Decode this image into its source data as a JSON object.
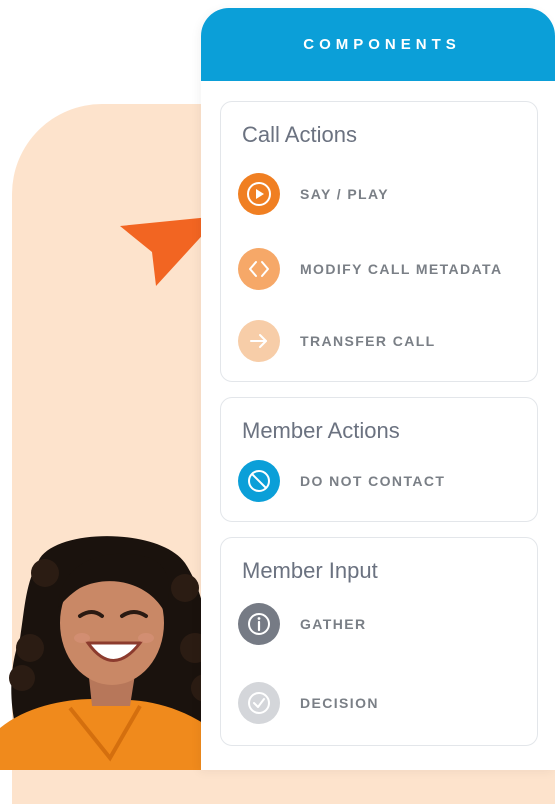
{
  "panel": {
    "title": "COMPONENTS"
  },
  "sections": [
    {
      "title": "Call Actions",
      "items": [
        {
          "label": "SAY / PLAY",
          "icon": "play-icon",
          "color": "#f07f22"
        },
        {
          "label": "MODIFY CALL METADATA",
          "icon": "code-brackets-icon",
          "color": "#f6a868"
        },
        {
          "label": "TRANSFER CALL",
          "icon": "arrow-right-icon",
          "color": "#f7cda8"
        }
      ]
    },
    {
      "title": "Member Actions",
      "items": [
        {
          "label": "DO NOT CONTACT",
          "icon": "prohibited-icon",
          "color": "#0b9fd8"
        }
      ]
    },
    {
      "title": "Member Input",
      "items": [
        {
          "label": "GATHER",
          "icon": "info-icon",
          "color": "#767b85"
        },
        {
          "label": "DECISION",
          "icon": "check-circle-icon",
          "color": "#d4d6da"
        }
      ]
    }
  ],
  "colors": {
    "header": "#0b9fd8",
    "accent_orange": "#f26522",
    "peach_background": "#fde3cc"
  }
}
